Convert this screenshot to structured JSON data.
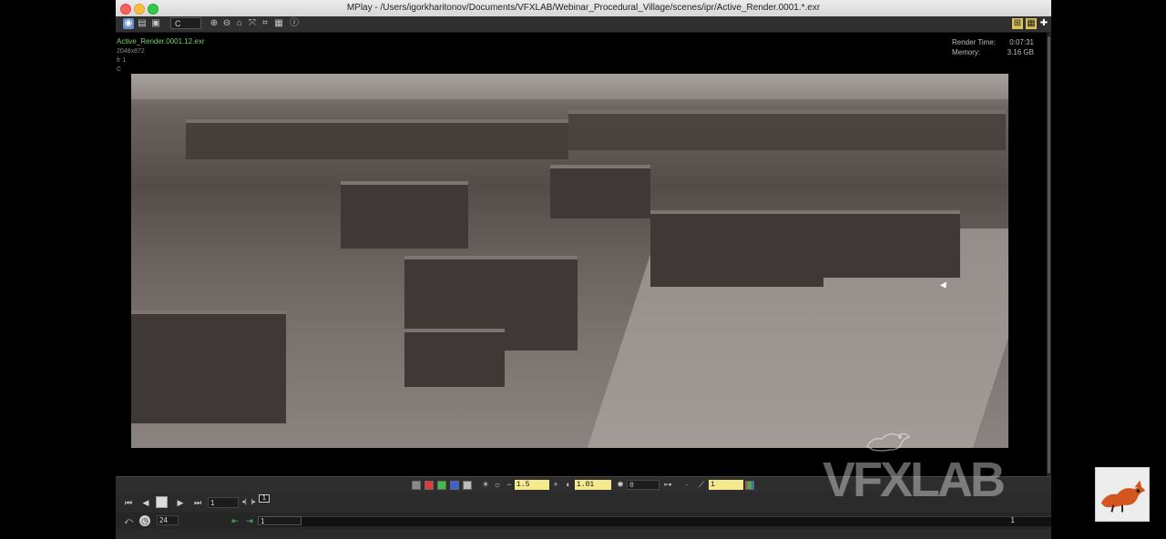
{
  "window": {
    "title": "MPlay - /Users/igorkharitonov/Documents/VFXLAB/Webinar_Procedural_Village/scenes/ipr/Active_Render.0001.*.exr"
  },
  "toolbar": {
    "channel_select": "C",
    "icons": [
      "view-mode-icon",
      "layout-icon",
      "display-icon",
      "zoom-in-icon",
      "zoom-out-icon",
      "home-icon",
      "fit-icon",
      "crop-icon",
      "snapshot-icon",
      "info-icon"
    ],
    "right_icons": [
      "compare-icon",
      "grid-icon",
      "add-icon"
    ]
  },
  "viewer": {
    "file_name": "Active_Render.0001.12.exr",
    "resolution": "2048x872",
    "frame_label": "fr 1",
    "channel_label": "C",
    "render_time_label": "Render Time:",
    "render_time_value": "0:07:31",
    "memory_label": "Memory:",
    "memory_value": "3.16 GB"
  },
  "color_controls": {
    "exposure": "1.5",
    "gamma": "1.01",
    "brightness": "0",
    "lut_value": "1"
  },
  "playback": {
    "current_frame": "1",
    "marker_frame": "1",
    "fps": "24",
    "range_start": "1",
    "range_end": "1"
  },
  "watermark": {
    "text": "VFXLAB"
  },
  "accent_colors": {
    "file_name": "#7bd06a",
    "field_highlight": "#f4e98c"
  }
}
